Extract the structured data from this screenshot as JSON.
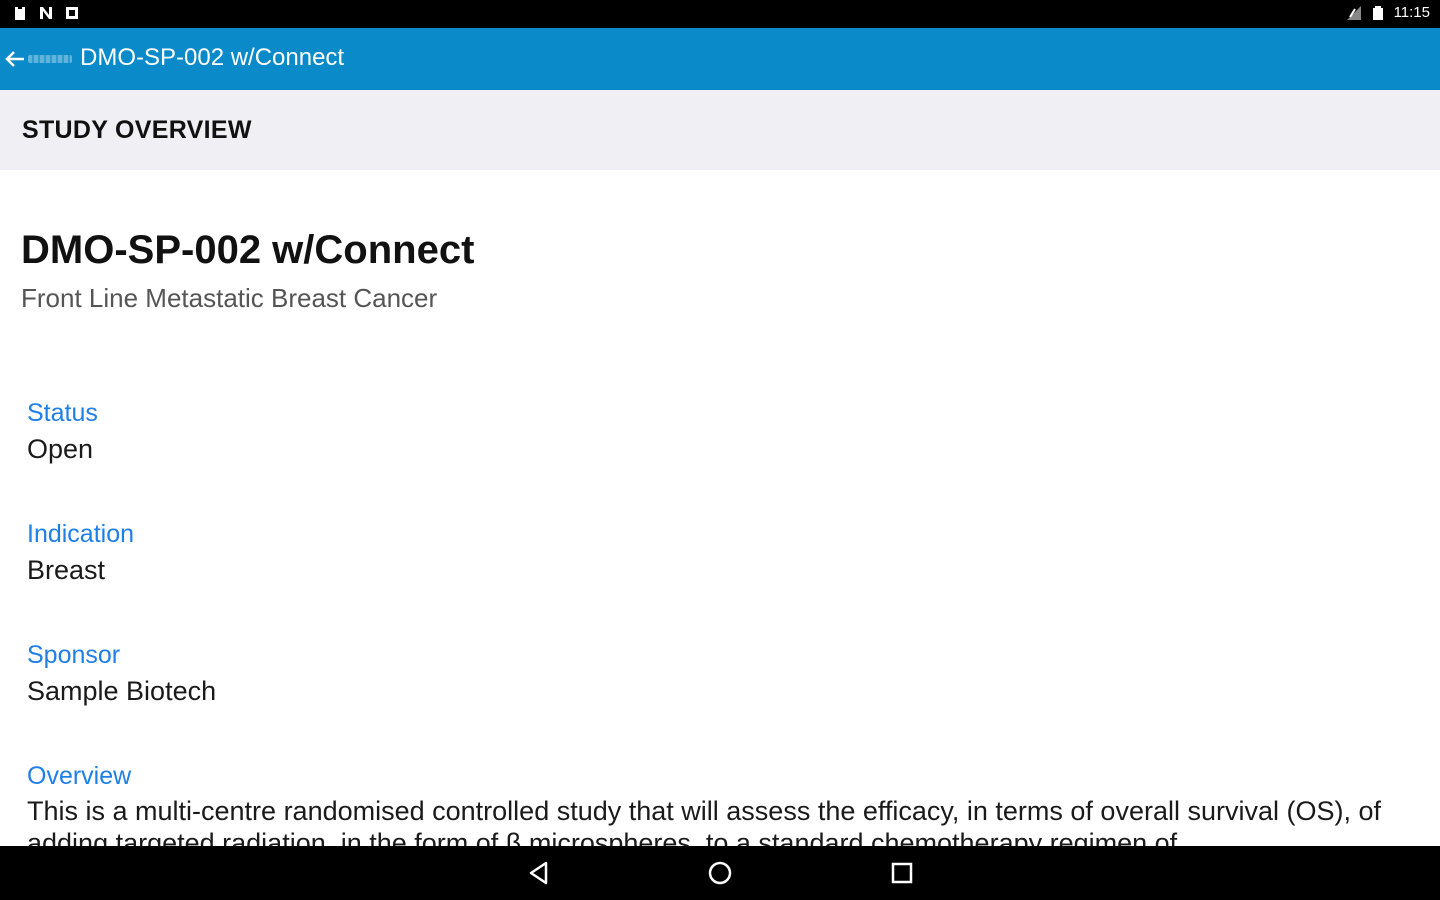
{
  "status_bar": {
    "time": "11:15",
    "left_icons": [
      "clipboard-icon",
      "n-icon",
      "square-icon"
    ],
    "right_icons": [
      "signal-icon",
      "battery-icon"
    ]
  },
  "app_bar": {
    "title": "DMO-SP-002 w/Connect",
    "back_icon": "back-arrow-icon",
    "color": "#0a8ac8"
  },
  "section": {
    "title": "STUDY OVERVIEW"
  },
  "study": {
    "title": "DMO-SP-002 w/Connect",
    "subtitle": "Front Line Metastatic Breast Cancer",
    "fields": [
      {
        "label": "Status",
        "value": "Open"
      },
      {
        "label": "Indication",
        "value": "Breast"
      },
      {
        "label": "Sponsor",
        "value": "Sample Biotech"
      },
      {
        "label": "Overview",
        "value": "This is a multi-centre randomised controlled study that will assess the efficacy, in terms of overall survival (OS), of adding targeted radiation, in the form of β microspheres, to a standard chemotherapy regimen of"
      }
    ]
  },
  "nav_bar": {
    "icons": [
      "back-triangle-icon",
      "home-circle-icon",
      "recents-square-icon"
    ]
  },
  "colors": {
    "label": "#1e7fe6",
    "header_bg": "#efeff4"
  }
}
